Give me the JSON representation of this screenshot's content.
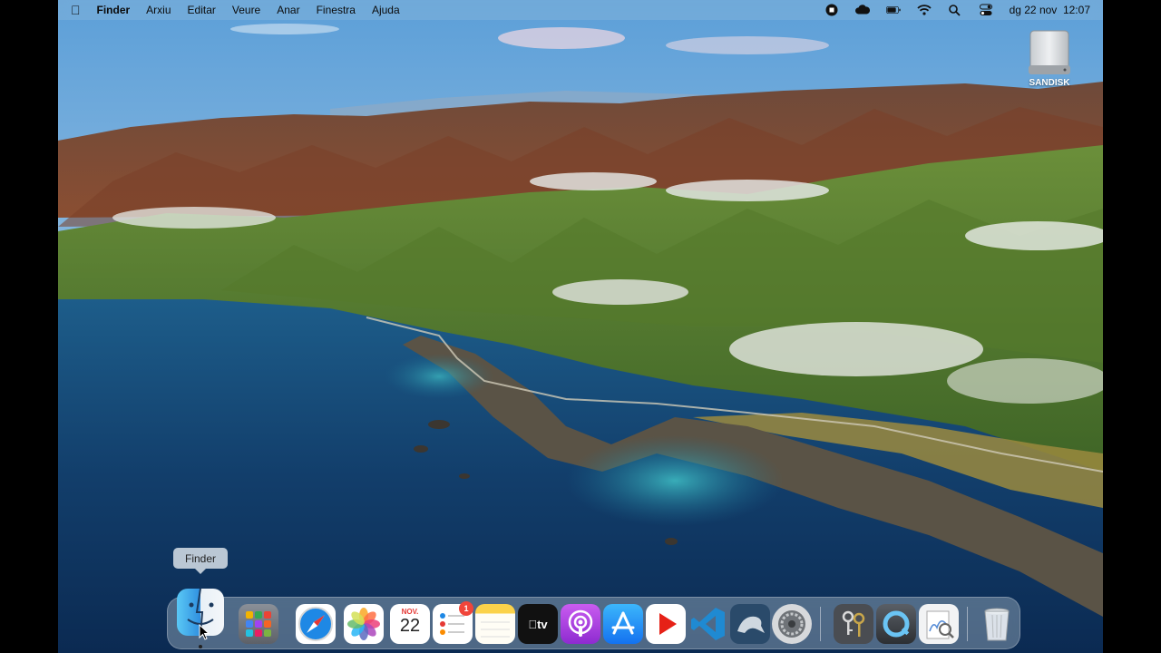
{
  "menubar": {
    "apple_icon": "apple-logo-icon",
    "app_name": "Finder",
    "menus": [
      "Arxiu",
      "Editar",
      "Veure",
      "Anar",
      "Finestra",
      "Ajuda"
    ],
    "status_icons": [
      "stop-recording-icon",
      "creative-cloud-icon",
      "battery-icon",
      "wifi-icon",
      "search-icon",
      "control-center-icon"
    ],
    "datetime": "dg 22 nov  12:07"
  },
  "desktop": {
    "volume_label": "SANDISK",
    "tooltip": "Finder"
  },
  "dock": {
    "apps": [
      {
        "name": "Finder",
        "icon": "finder-icon",
        "running": true
      },
      {
        "name": "Launchpad",
        "icon": "launchpad-icon"
      },
      {
        "name": "Safari",
        "icon": "safari-icon"
      },
      {
        "name": "Photos",
        "icon": "photos-icon"
      },
      {
        "name": "Calendar",
        "icon": "calendar-icon",
        "month": "NOV.",
        "day": "22"
      },
      {
        "name": "Reminders",
        "icon": "reminders-icon",
        "badge": "1"
      },
      {
        "name": "Notes",
        "icon": "notes-icon"
      },
      {
        "name": "TV",
        "icon": "apple-tv-icon",
        "label": "tv"
      },
      {
        "name": "Podcasts",
        "icon": "podcasts-icon"
      },
      {
        "name": "App Store",
        "icon": "app-store-icon"
      },
      {
        "name": "YouTube",
        "icon": "youtube-icon"
      },
      {
        "name": "Visual Studio Code",
        "icon": "vscode-icon"
      },
      {
        "name": "MySQL Workbench",
        "icon": "mysql-workbench-icon"
      },
      {
        "name": "System Preferences",
        "icon": "system-preferences-icon"
      },
      {
        "name": "Keychain Access",
        "icon": "keychain-icon"
      },
      {
        "name": "QuickTime Player",
        "icon": "quicktime-icon"
      },
      {
        "name": "Preview",
        "icon": "preview-icon"
      },
      {
        "name": "Trash",
        "icon": "trash-icon"
      }
    ]
  }
}
